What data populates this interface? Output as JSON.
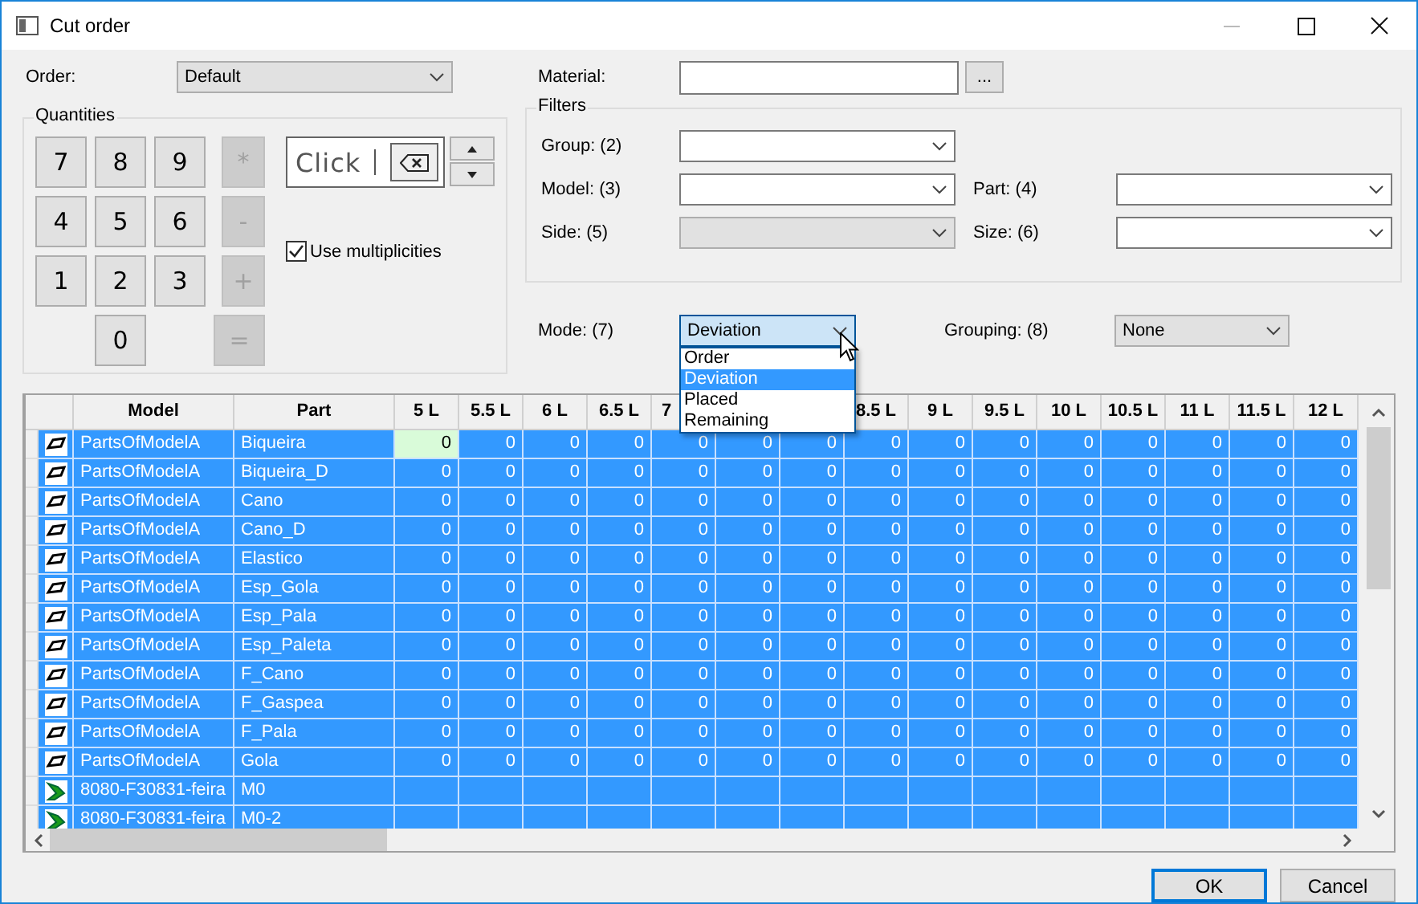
{
  "window": {
    "title": "Cut order"
  },
  "order": {
    "label": "Order:",
    "value": "Default"
  },
  "quantities": {
    "title": "Quantities",
    "keys": [
      {
        "label": "7",
        "disabled": false
      },
      {
        "label": "8",
        "disabled": false
      },
      {
        "label": "9",
        "disabled": false
      },
      {
        "label": "*",
        "disabled": true
      },
      {
        "label": "4",
        "disabled": false
      },
      {
        "label": "5",
        "disabled": false
      },
      {
        "label": "6",
        "disabled": false
      },
      {
        "label": "-",
        "disabled": true
      },
      {
        "label": "1",
        "disabled": false
      },
      {
        "label": "2",
        "disabled": false
      },
      {
        "label": "3",
        "disabled": false
      },
      {
        "label": "+",
        "disabled": true
      },
      {
        "label": "0",
        "disabled": false
      },
      {
        "label": "=",
        "disabled": true
      }
    ],
    "entry": {
      "value": "Click"
    },
    "use_multiplicities": {
      "label": "Use multiplicities",
      "checked": true
    }
  },
  "material": {
    "label": "Material:",
    "browse": "..."
  },
  "filters": {
    "title": "Filters",
    "group": {
      "label": "Group: (2)",
      "disabled": false
    },
    "model": {
      "label": "Model: (3)",
      "disabled": false
    },
    "part": {
      "label": "Part: (4)",
      "disabled": false
    },
    "side": {
      "label": "Side: (5)",
      "disabled": true
    },
    "size": {
      "label": "Size: (6)",
      "disabled": false
    }
  },
  "mode": {
    "label": "Mode: (7)",
    "value": "Deviation",
    "options": [
      {
        "label": "Order",
        "selected": false
      },
      {
        "label": "Deviation",
        "selected": true
      },
      {
        "label": "Placed",
        "selected": false
      },
      {
        "label": "Remaining",
        "selected": false
      }
    ]
  },
  "grouping": {
    "label": "Grouping: (8)",
    "value": "None"
  },
  "table": {
    "columns": [
      {
        "label": "Model"
      },
      {
        "label": "Part"
      },
      {
        "label": "5 L"
      },
      {
        "label": "5.5 L"
      },
      {
        "label": "6 L"
      },
      {
        "label": "6.5 L"
      },
      {
        "label": "7"
      },
      {},
      {},
      {
        "label": "8.5 L"
      },
      {
        "label": "9 L"
      },
      {
        "label": "9.5 L"
      },
      {
        "label": "10 L"
      },
      {
        "label": "10.5 L"
      },
      {
        "label": "11 L"
      },
      {
        "label": "11.5 L"
      },
      {
        "label": "12 L"
      }
    ],
    "rows": [
      {
        "kind": "part",
        "selected": true,
        "focused": true,
        "model": "PartsOfModelA",
        "part": "Biqueira",
        "values": [
          "0",
          "0",
          "0",
          "0",
          "0",
          "0",
          "0",
          "0",
          "0",
          "0",
          "0",
          "0",
          "0",
          "0",
          "0"
        ]
      },
      {
        "kind": "part",
        "selected": true,
        "focused": false,
        "model": "PartsOfModelA",
        "part": "Biqueira_D",
        "values": [
          "0",
          "0",
          "0",
          "0",
          "0",
          "0",
          "0",
          "0",
          "0",
          "0",
          "0",
          "0",
          "0",
          "0",
          "0"
        ]
      },
      {
        "kind": "part",
        "selected": true,
        "focused": false,
        "model": "PartsOfModelA",
        "part": "Cano",
        "values": [
          "0",
          "0",
          "0",
          "0",
          "0",
          "0",
          "0",
          "0",
          "0",
          "0",
          "0",
          "0",
          "0",
          "0",
          "0"
        ]
      },
      {
        "kind": "part",
        "selected": true,
        "focused": false,
        "model": "PartsOfModelA",
        "part": "Cano_D",
        "values": [
          "0",
          "0",
          "0",
          "0",
          "0",
          "0",
          "0",
          "0",
          "0",
          "0",
          "0",
          "0",
          "0",
          "0",
          "0"
        ]
      },
      {
        "kind": "part",
        "selected": true,
        "focused": false,
        "model": "PartsOfModelA",
        "part": "Elastico",
        "values": [
          "0",
          "0",
          "0",
          "0",
          "0",
          "0",
          "0",
          "0",
          "0",
          "0",
          "0",
          "0",
          "0",
          "0",
          "0"
        ]
      },
      {
        "kind": "part",
        "selected": true,
        "focused": false,
        "model": "PartsOfModelA",
        "part": "Esp_Gola",
        "values": [
          "0",
          "0",
          "0",
          "0",
          "0",
          "0",
          "0",
          "0",
          "0",
          "0",
          "0",
          "0",
          "0",
          "0",
          "0"
        ]
      },
      {
        "kind": "part",
        "selected": true,
        "focused": false,
        "model": "PartsOfModelA",
        "part": "Esp_Pala",
        "values": [
          "0",
          "0",
          "0",
          "0",
          "0",
          "0",
          "0",
          "0",
          "0",
          "0",
          "0",
          "0",
          "0",
          "0",
          "0"
        ]
      },
      {
        "kind": "part",
        "selected": true,
        "focused": false,
        "model": "PartsOfModelA",
        "part": "Esp_Paleta",
        "values": [
          "0",
          "0",
          "0",
          "0",
          "0",
          "0",
          "0",
          "0",
          "0",
          "0",
          "0",
          "0",
          "0",
          "0",
          "0"
        ]
      },
      {
        "kind": "part",
        "selected": true,
        "focused": false,
        "model": "PartsOfModelA",
        "part": "F_Cano",
        "values": [
          "0",
          "0",
          "0",
          "0",
          "0",
          "0",
          "0",
          "0",
          "0",
          "0",
          "0",
          "0",
          "0",
          "0",
          "0"
        ]
      },
      {
        "kind": "part",
        "selected": true,
        "focused": false,
        "model": "PartsOfModelA",
        "part": "F_Gaspea",
        "values": [
          "0",
          "0",
          "0",
          "0",
          "0",
          "0",
          "0",
          "0",
          "0",
          "0",
          "0",
          "0",
          "0",
          "0",
          "0"
        ]
      },
      {
        "kind": "part",
        "selected": true,
        "focused": false,
        "model": "PartsOfModelA",
        "part": "F_Pala",
        "values": [
          "0",
          "0",
          "0",
          "0",
          "0",
          "0",
          "0",
          "0",
          "0",
          "0",
          "0",
          "0",
          "0",
          "0",
          "0"
        ]
      },
      {
        "kind": "part",
        "selected": true,
        "focused": false,
        "model": "PartsOfModelA",
        "part": "Gola",
        "values": [
          "0",
          "0",
          "0",
          "0",
          "0",
          "0",
          "0",
          "0",
          "0",
          "0",
          "0",
          "0",
          "0",
          "0",
          "0"
        ]
      },
      {
        "kind": "model",
        "selected": true,
        "focused": false,
        "model": "8080-F30831-feira",
        "part": "M0"
      },
      {
        "kind": "model",
        "selected": true,
        "focused": false,
        "model": "8080-F30831-feira",
        "part": "M0-2"
      }
    ]
  },
  "buttons": [
    {
      "label": "OK",
      "default": true
    },
    {
      "label": "Cancel",
      "default": false
    }
  ]
}
